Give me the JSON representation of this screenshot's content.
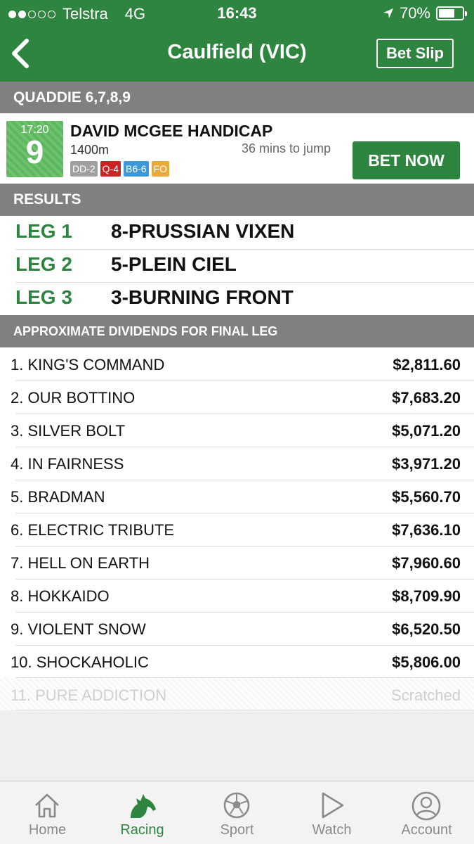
{
  "status_bar": {
    "carrier": "Telstra",
    "network": "4G",
    "time": "16:43",
    "battery": "70%",
    "battery_level": 0.7
  },
  "nav": {
    "title": "Caulfield (VIC)",
    "bet_slip_label": "Bet Slip"
  },
  "quaddie_header": "QUADDIE 6,7,8,9",
  "race": {
    "time": "17:20",
    "number": "9",
    "name": "DAVID MCGEE HANDICAP",
    "distance": "1400m",
    "jump": "36 mins to jump",
    "tags": [
      {
        "label": "DD-2",
        "color": "#a0a0a0"
      },
      {
        "label": "Q-4",
        "color": "#cc2222"
      },
      {
        "label": "B6-6",
        "color": "#3a9ad9"
      },
      {
        "label": "FO",
        "color": "#e8a93a"
      }
    ],
    "bet_now_label": "BET NOW"
  },
  "results_header": "RESULTS",
  "results": [
    {
      "leg": "LEG 1",
      "value": "8-PRUSSIAN VIXEN"
    },
    {
      "leg": "LEG 2",
      "value": "5-PLEIN CIEL"
    },
    {
      "leg": "LEG 3",
      "value": "3-BURNING FRONT"
    }
  ],
  "dividends_header": "APPROXIMATE DIVIDENDS FOR FINAL LEG",
  "dividends": [
    {
      "name": "1. KING'S COMMAND",
      "value": "$2,811.60"
    },
    {
      "name": "2. OUR BOTTINO",
      "value": "$7,683.20"
    },
    {
      "name": "3. SILVER BOLT",
      "value": "$5,071.20"
    },
    {
      "name": "4. IN FAIRNESS",
      "value": "$3,971.20"
    },
    {
      "name": "5. BRADMAN",
      "value": "$5,560.70"
    },
    {
      "name": "6. ELECTRIC TRIBUTE",
      "value": "$7,636.10"
    },
    {
      "name": "7. HELL ON EARTH",
      "value": "$7,960.60"
    },
    {
      "name": "8. HOKKAIDO",
      "value": "$8,709.90"
    },
    {
      "name": "9. VIOLENT SNOW",
      "value": "$6,520.50"
    },
    {
      "name": "10. SHOCKAHOLIC",
      "value": "$5,806.00"
    },
    {
      "name": "11. PURE ADDICTION",
      "value": "Scratched"
    }
  ],
  "tabs": [
    {
      "label": "Home",
      "icon": "home-icon"
    },
    {
      "label": "Racing",
      "icon": "horse-icon"
    },
    {
      "label": "Sport",
      "icon": "soccer-ball-icon"
    },
    {
      "label": "Watch",
      "icon": "play-icon"
    },
    {
      "label": "Account",
      "icon": "user-icon"
    }
  ],
  "colors": {
    "brand_green": "#2e8540",
    "badge_green": "#5cb85c",
    "section_grey": "#808080"
  }
}
